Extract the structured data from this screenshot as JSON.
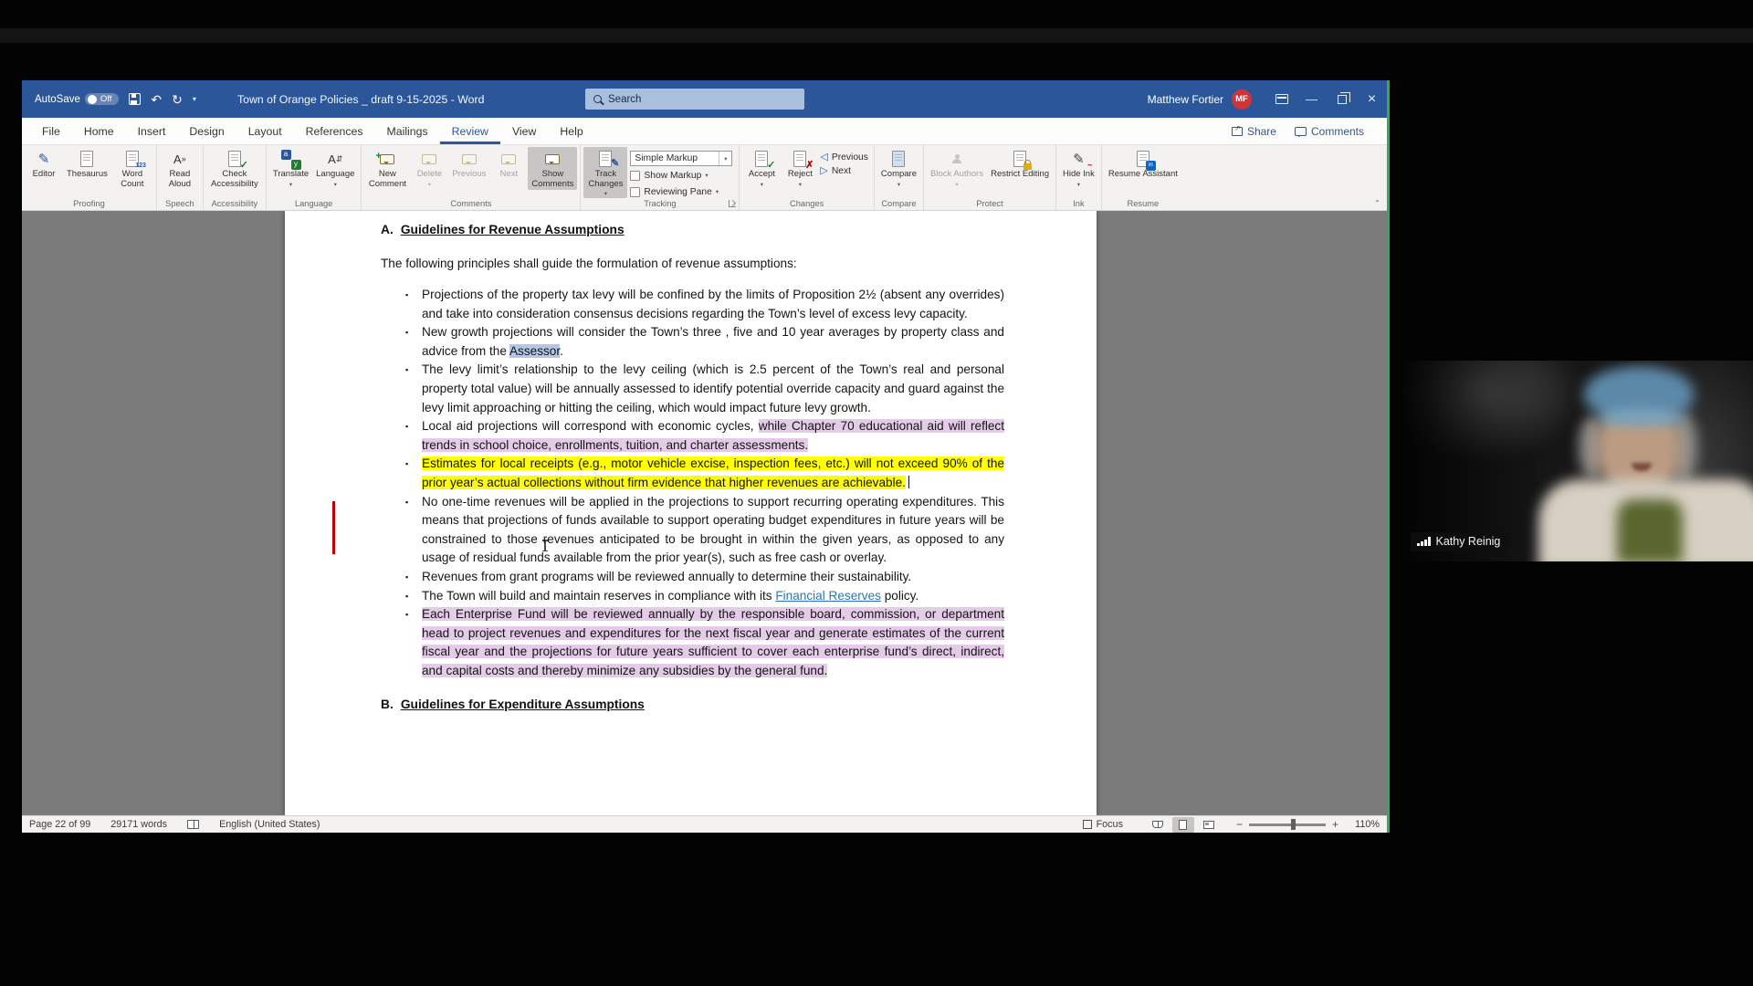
{
  "colors": {
    "titlebar_blue": "#2b579a",
    "highlight_yellow": "#ffff00",
    "highlight_purple": "#e4cbe7",
    "selection_blue": "#b3c6e7",
    "link_blue": "#2e74b5",
    "change_bar_red": "#c00000",
    "share_border_green": "#2fae4f",
    "avatar_red": "#d13438"
  },
  "titlebar": {
    "autosave_label": "AutoSave",
    "autosave_state": "Off",
    "title": "Town of Orange Policies _ draft 9-15-2025  -  Word",
    "search_placeholder": "Search",
    "user_name": "Matthew Fortier",
    "user_initials": "MF"
  },
  "tabs": [
    "File",
    "Home",
    "Insert",
    "Design",
    "Layout",
    "References",
    "Mailings",
    "Review",
    "View",
    "Help"
  ],
  "active_tab": "Review",
  "top_actions": {
    "share": "Share",
    "comments": "Comments"
  },
  "ribbon": {
    "groups": [
      {
        "label": "Proofing",
        "buttons": [
          {
            "label": "Editor"
          },
          {
            "label": "Thesaurus"
          },
          {
            "label": "Word Count"
          }
        ]
      },
      {
        "label": "Speech",
        "buttons": [
          {
            "label": "Read Aloud"
          }
        ]
      },
      {
        "label": "Accessibility",
        "buttons": [
          {
            "label": "Check Accessibility"
          }
        ]
      },
      {
        "label": "Language",
        "buttons": [
          {
            "label": "Translate"
          },
          {
            "label": "Language"
          }
        ]
      },
      {
        "label": "Comments",
        "buttons": [
          {
            "label": "New Comment"
          },
          {
            "label": "Delete"
          },
          {
            "label": "Previous"
          },
          {
            "label": "Next"
          },
          {
            "label": "Show Comments"
          }
        ]
      },
      {
        "label": "Tracking",
        "buttons": [
          {
            "label": "Track Changes"
          }
        ],
        "markup_mode": "Simple Markup",
        "show_markup": "Show Markup",
        "reviewing_pane": "Reviewing Pane"
      },
      {
        "label": "Changes",
        "buttons": [
          {
            "label": "Accept"
          },
          {
            "label": "Reject"
          },
          {
            "label": "Previous"
          },
          {
            "label": "Next"
          }
        ]
      },
      {
        "label": "Compare",
        "buttons": [
          {
            "label": "Compare"
          }
        ]
      },
      {
        "label": "Protect",
        "buttons": [
          {
            "label": "Block Authors"
          },
          {
            "label": "Restrict Editing"
          }
        ]
      },
      {
        "label": "Ink",
        "buttons": [
          {
            "label": "Hide Ink"
          }
        ]
      },
      {
        "label": "Resume",
        "buttons": [
          {
            "label": "Resume Assistant"
          }
        ]
      }
    ]
  },
  "document": {
    "heading_a_num": "A.",
    "heading_a": "Guidelines for Revenue Assumptions",
    "intro": "The following principles shall guide the formulation of revenue assumptions:",
    "bullets": [
      {
        "segments": [
          {
            "style": "plain",
            "text": "Projections of the property tax levy will be confined by the limits of Proposition 2½ (absent any overrides) and take into consideration consensus decisions regarding the Town’s level of excess levy capacity."
          }
        ]
      },
      {
        "segments": [
          {
            "style": "plain",
            "text": "New growth projections will consider the Town’s three , five  and 10 year averages by property class and advice from the "
          },
          {
            "style": "selection",
            "text": "Assessor"
          },
          {
            "style": "plain",
            "text": "."
          }
        ]
      },
      {
        "segments": [
          {
            "style": "plain",
            "text": "The levy limit’s relationship to the levy ceiling (which is 2.5 percent of the Town’s real and personal property total value) will be annually assessed to identify potential override capacity and guard against the levy limit approaching or hitting the ceiling, which would impact future levy growth."
          }
        ]
      },
      {
        "segments": [
          {
            "style": "plain",
            "text": "Local aid projections will correspond with economic cycles, "
          },
          {
            "style": "purple",
            "text": "while Chapter 70 educational aid will reflect trends in school choice, enrollments, tuition, and charter assessments."
          }
        ]
      },
      {
        "segments": [
          {
            "style": "yellow",
            "text": "Estimates for local receipts (e.g., motor vehicle excise, inspection fees, etc.) will not exceed 90% of the prior year’s actual collections without firm evidence that higher revenues are achievable."
          }
        ]
      },
      {
        "segments": [
          {
            "style": "plain",
            "text": "No one-time revenues will be applied in the projections to support recurring operating expenditures. This means that projections of funds available to support operating budget expenditures in future years will be constrained to those revenues anticipated to be brought in within the given years, as opposed to any usage of residual funds available from the prior year(s), such as free cash or overlay."
          }
        ]
      },
      {
        "segments": [
          {
            "style": "plain",
            "text": "Revenues from grant programs will be reviewed annually to determine their sustainability."
          }
        ]
      },
      {
        "segments": [
          {
            "style": "plain",
            "text": "The Town will build and maintain reserves in compliance with its "
          },
          {
            "style": "link",
            "text": "Financial Reserves"
          },
          {
            "style": "plain",
            "text": " policy."
          }
        ]
      },
      {
        "segments": [
          {
            "style": "purple",
            "text": "Each Enterprise Fund will be reviewed annually by the responsible board, commission, or department head to project revenues and expenditures for the next fiscal year and generate estimates of the current fiscal year and the projections for future years sufficient to cover each enterprise fund’s direct, indirect, and capital costs and thereby minimize any subsidies by the general fund."
          }
        ]
      }
    ],
    "heading_b_num": "B.",
    "heading_b": "Guidelines for Expenditure Assumptions"
  },
  "statusbar": {
    "page_info": "Page 22 of 99",
    "word_count": "29171 words",
    "language": "English (United States)",
    "focus_label": "Focus",
    "zoom_level": "110%"
  },
  "webcam": {
    "participant_name": "Kathy Reinig"
  }
}
